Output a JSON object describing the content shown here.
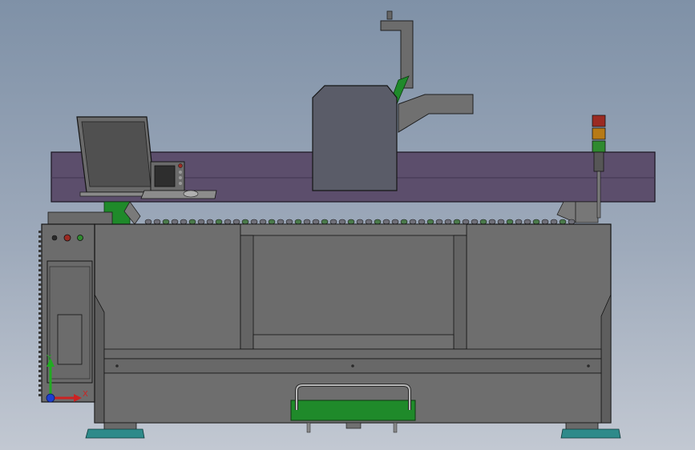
{
  "scene": {
    "view": "front",
    "colors": {
      "background_top": "#7f91a7",
      "background_bottom": "#c2c8d2",
      "body": "#6e6e6e",
      "body_dark": "#5e5e5e",
      "gantry": "#5c4e6c",
      "head": "#5a5c68",
      "green_parts": "#1f8a2a",
      "feet": "#2e8a8a",
      "beacon_red": "#9b2a22",
      "beacon_amber": "#b77a16",
      "beacon_green": "#2f8a2f"
    }
  },
  "triad": {
    "x_label": "X",
    "y_label": "Y",
    "x_color": "#cc2222",
    "y_color": "#22aa22",
    "origin_color": "#1d3fd0"
  }
}
